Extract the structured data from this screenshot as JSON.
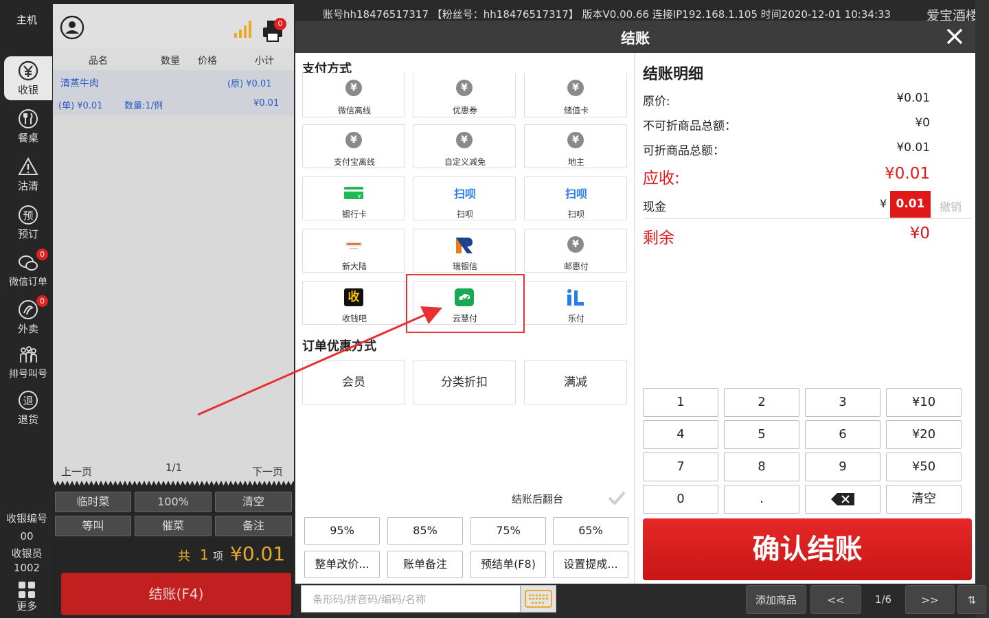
{
  "nav": {
    "host_label": "主机",
    "items": [
      {
        "label": "收银",
        "icon": "yen-circle-icon"
      },
      {
        "label": "餐桌",
        "icon": "fork-knife-icon"
      },
      {
        "label": "沽清",
        "icon": "warning-triangle-icon"
      },
      {
        "label": "预订",
        "icon": "reserve-icon"
      },
      {
        "label": "微信订单",
        "icon": "wechat-icon",
        "badge": "0"
      },
      {
        "label": "外卖",
        "icon": "takeout-icon",
        "badge": "0"
      },
      {
        "label": "排号叫号",
        "icon": "queue-icon"
      },
      {
        "label": "退货",
        "icon": "refund-icon"
      }
    ],
    "cashier_no_label": "收银编号",
    "cashier_no": "00",
    "cashier_label": "收银员",
    "cashier_id": "1002",
    "more_label": "更多"
  },
  "order": {
    "printer_badge": "0",
    "columns": [
      "品名",
      "数量",
      "价格",
      "小计"
    ],
    "items": [
      {
        "name": "清蒸牛肉",
        "orig_price": "(原) ¥0.01",
        "unit_price": "(单) ¥0.01",
        "qty": "数量:1/例",
        "subtotal": "¥0.01"
      }
    ],
    "prev_page": "上一页",
    "page": "1/1",
    "next_page": "下一页",
    "buttons": [
      "临时菜",
      "100%",
      "清空",
      "等叫",
      "催菜",
      "备注"
    ],
    "total_prefix": "共",
    "total_count": "1",
    "total_unit": "项",
    "total_amount": "¥0.01",
    "checkout_label": "结账(F4)"
  },
  "topbar": {
    "text": "账号hh18476517317 【粉丝号：hh18476517317】 版本V0.00.66 连接IP192.168.1.105 时间2020-12-01 10:34:33",
    "brand": "爱宝酒楼"
  },
  "modal": {
    "title": "结账",
    "pay_section": "支付方式",
    "pay_methods": [
      {
        "label": "微信离线",
        "icon": "yen-icon"
      },
      {
        "label": "优惠券",
        "icon": "yen-icon"
      },
      {
        "label": "储值卡",
        "icon": "yen-icon"
      },
      {
        "label": "支付宝离线",
        "icon": "yen-icon"
      },
      {
        "label": "自定义减免",
        "icon": "yen-icon"
      },
      {
        "label": "地主",
        "icon": "yen-icon"
      },
      {
        "label": "银行卡",
        "icon": "bank-card-icon"
      },
      {
        "label": "扫呗",
        "icon": "saobei-icon",
        "icon_text": "扫呗"
      },
      {
        "label": "扫呗",
        "icon": "saobei-icon",
        "icon_text": "扫呗"
      },
      {
        "label": "新大陆",
        "icon": "newland-icon"
      },
      {
        "label": "瑞银信",
        "icon": "ruiyinxin-icon"
      },
      {
        "label": "邮惠付",
        "icon": "yen-icon"
      },
      {
        "label": "收钱吧",
        "icon": "shouqianba-icon",
        "icon_text": "收"
      },
      {
        "label": "云慧付",
        "icon": "yunhuifu-icon"
      },
      {
        "label": "乐付",
        "icon": "lefu-icon"
      }
    ],
    "discount_section": "订单优惠方式",
    "discounts": [
      "会员",
      "分类折扣",
      "满减"
    ],
    "flip_label": "结账后翻台",
    "percents": [
      "95%",
      "85%",
      "75%",
      "65%"
    ],
    "actions": [
      "整单改价...",
      "账单备注",
      "预结单(F8)",
      "设置提成..."
    ],
    "detail_title": "结账明细",
    "detail": {
      "original_label": "原价:",
      "original_value": "¥0.01",
      "nondisc_label": "不可折商品总额：",
      "nondisc_value": "¥0",
      "disc_label": "可折商品总额：",
      "disc_value": "¥0.01",
      "due_label": "应收:",
      "due_value": "¥0.01",
      "cash_label": "现金",
      "cash_symbol": "¥",
      "cash_value": "0.01",
      "undo_label": "撤销",
      "remain_label": "剩余",
      "remain_value": "¥0"
    },
    "keypad": [
      "1",
      "2",
      "3",
      "¥10",
      "4",
      "5",
      "6",
      "¥20",
      "7",
      "8",
      "9",
      "¥50",
      "0",
      ".",
      "",
      "清空"
    ],
    "confirm_label": "确认结账"
  },
  "search": {
    "placeholder": "条形码/拼音码/编码/名称"
  },
  "bottombar": {
    "add_label": "添加商品",
    "prev": "<<",
    "page": "1/6",
    "next": ">>",
    "sort": "⇅"
  }
}
